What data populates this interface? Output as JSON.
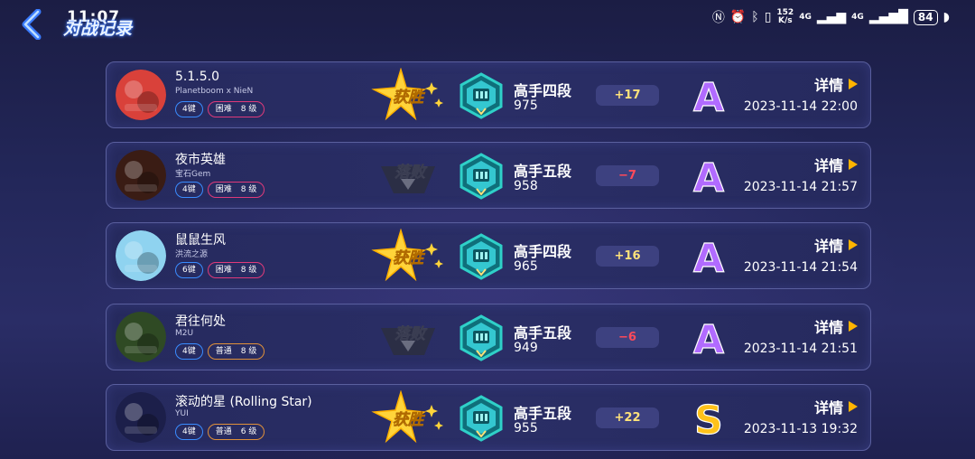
{
  "status_bar": {
    "time": "11:07",
    "speed_value": "152",
    "speed_unit": "K/s",
    "network_1": "4G",
    "network_2": "4G",
    "battery": "84"
  },
  "header": {
    "title": "对战记录"
  },
  "records": [
    {
      "song": "5.1.5.0",
      "artist": "Planetboom x NieN",
      "keys": "4键",
      "difficulty": "困难",
      "level": "8 级",
      "difficulty_style": "hard",
      "result": "获胜",
      "result_type": "win",
      "rank_name": "高手四段",
      "rank_score": "975",
      "delta": "+17",
      "delta_type": "up",
      "grade": "A",
      "detail_label": "详情",
      "datetime": "2023-11-14 22:00",
      "avatar_color": "#d9413a"
    },
    {
      "song": "夜市英雄",
      "artist": "宝石Gem",
      "keys": "4键",
      "difficulty": "困难",
      "level": "8 级",
      "difficulty_style": "hard",
      "result": "落败",
      "result_type": "lose",
      "rank_name": "高手五段",
      "rank_score": "958",
      "delta": "−7",
      "delta_type": "down",
      "grade": "A",
      "detail_label": "详情",
      "datetime": "2023-11-14 21:57",
      "avatar_color": "#3a1c14"
    },
    {
      "song": "鼠鼠生风",
      "artist": "洪流之源",
      "keys": "6键",
      "difficulty": "困难",
      "level": "8 级",
      "difficulty_style": "hard",
      "result": "获胜",
      "result_type": "win",
      "rank_name": "高手四段",
      "rank_score": "965",
      "delta": "+16",
      "delta_type": "up",
      "grade": "A",
      "detail_label": "详情",
      "datetime": "2023-11-14 21:54",
      "avatar_color": "#8fd3f0"
    },
    {
      "song": "君往何处",
      "artist": "M2U",
      "keys": "4键",
      "difficulty": "普通",
      "level": "8 级",
      "difficulty_style": "normal",
      "result": "落败",
      "result_type": "lose",
      "rank_name": "高手五段",
      "rank_score": "949",
      "delta": "−6",
      "delta_type": "down",
      "grade": "A",
      "detail_label": "详情",
      "datetime": "2023-11-14 21:51",
      "avatar_color": "#2f4a24"
    },
    {
      "song": "滚动的星 (Rolling Star)",
      "artist": "YUI",
      "keys": "4键",
      "difficulty": "普通",
      "level": "6 级",
      "difficulty_style": "normal",
      "result": "获胜",
      "result_type": "win",
      "rank_name": "高手五段",
      "rank_score": "955",
      "delta": "+22",
      "delta_type": "up",
      "grade": "S",
      "detail_label": "详情",
      "datetime": "2023-11-13 19:32",
      "avatar_color": "#1c1f4a"
    }
  ],
  "colors": {
    "win_gold": "#ffd43a",
    "lose_gray": "#6a6d80",
    "grade_a": "#b16bff",
    "grade_s": "#ffc21a",
    "badge_teal": "#2fd0c8"
  }
}
